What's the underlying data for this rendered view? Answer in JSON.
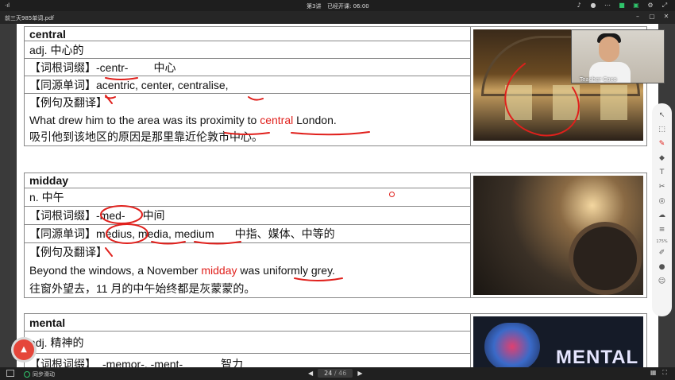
{
  "status": {
    "signal": "·ıl",
    "lesson": "第3讲",
    "elapsed": "已经开课: 06:00"
  },
  "file": {
    "name": "前三天985单词.pdf"
  },
  "entries": [
    {
      "word": "central",
      "pos": "adj.  中心的",
      "root_label": "【词根词缀】",
      "root_value": "-centr-",
      "root_meaning": "中心",
      "cognate_label": "【同源单词】",
      "cognate_value": "acentric, center,   centralise,",
      "example_label": "【例句及翻译】",
      "example_before": "What drew him to the area was its proximity to ",
      "example_highlight": "central",
      "example_after": " London.",
      "translation": "吸引他到该地区的原因是那里靠近伦敦市中心。"
    },
    {
      "word": "midday",
      "pos": "n.  中午",
      "root_label": "【词根词缀】",
      "root_value": "-med-",
      "root_meaning": "中间",
      "cognate_label": "【同源单词】",
      "cognate_value": "medius, media, medium",
      "cognate_meaning": "中指、媒体、中等的",
      "example_label": "【例句及翻译】",
      "example_before": "Beyond the windows, a November ",
      "example_highlight": "midday",
      "example_after": " was uniformly grey.",
      "translation": "往窗外望去，11 月的中午始终都是灰蒙蒙的。"
    },
    {
      "word": "mental",
      "pos": "adj.  精神的",
      "root_label": "【词根词缀】",
      "root_value": "-memor-, -ment-",
      "root_meaning": "智力",
      "image_text": "MENTAL"
    }
  ],
  "webcam": {
    "name": "Teacher Coco"
  },
  "pager": {
    "current": "24",
    "total": "/ 46"
  },
  "sync": {
    "label": "同步滑动"
  },
  "rail": {
    "zoom": "175%"
  },
  "colors": {
    "highlight": "#e0201c",
    "ink": "#e0201c",
    "accent": "#2fc36a"
  }
}
